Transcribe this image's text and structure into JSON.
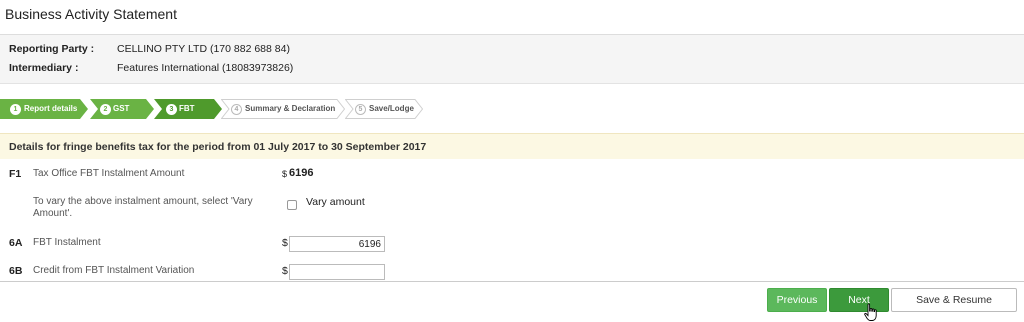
{
  "page": {
    "title": "Business Activity Statement"
  },
  "reporting": {
    "party_label": "Reporting Party :",
    "party_value": "CELLINO PTY LTD (170 882 688 84)",
    "intermediary_label": "Intermediary :",
    "intermediary_value": "Features International (18083973826)"
  },
  "steps": [
    {
      "num": "1",
      "label": "Report details",
      "state": "done"
    },
    {
      "num": "2",
      "label": "GST",
      "state": "done"
    },
    {
      "num": "3",
      "label": "FBT",
      "state": "active"
    },
    {
      "num": "4",
      "label": "Summary & Declaration",
      "state": "todo"
    },
    {
      "num": "5",
      "label": "Save/Lodge",
      "state": "todo"
    }
  ],
  "period": {
    "text": "Details for fringe benefits tax for the period from 01 July 2017 to 30 September 2017"
  },
  "fields": {
    "f1": {
      "code": "F1",
      "label": "Tax Office FBT Instalment Amount",
      "currency": "$",
      "amount": "6196"
    },
    "vary": {
      "text": "To vary the above instalment amount, select 'Vary Amount'.",
      "checkbox_label": "Vary amount",
      "checked": false
    },
    "a6": {
      "code": "6A",
      "label": "FBT Instalment",
      "currency": "$",
      "value": "6196"
    },
    "b6": {
      "code": "6B",
      "label": "Credit from FBT Instalment Variation",
      "currency": "$",
      "value": ""
    }
  },
  "footer": {
    "previous": "Previous",
    "next": "Next",
    "save_resume": "Save & Resume"
  },
  "colors": {
    "green": "#6ab344",
    "green_dark": "#4f9a2c",
    "banner": "#fcf8e3"
  }
}
